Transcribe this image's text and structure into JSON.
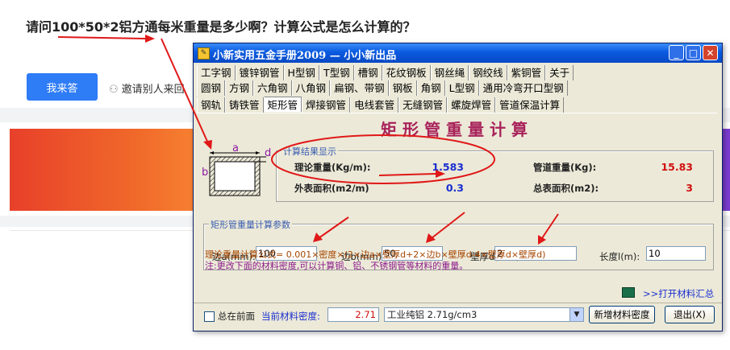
{
  "page": {
    "question_title": "请问100*50*2铝方通每米重量是多少啊？计算公式是怎么计算的？",
    "answer_button": "我来答",
    "invite_text": "邀请别人来回"
  },
  "window": {
    "title": "小新实用五金手册2009 — 小小新出品",
    "tabs_row1": [
      "工字钢",
      "镀锌钢管",
      "H型钢",
      "T型钢",
      "槽钢",
      "花纹钢板",
      "钢丝绳",
      "钢绞线",
      "紫铜管",
      "关于"
    ],
    "tabs_row2": [
      "圆钢",
      "方钢",
      "六角钢",
      "八角钢",
      "扁钢、带钢",
      "钢板",
      "角钢",
      "L型钢",
      "通用冷弯开口型钢"
    ],
    "tabs_row3": [
      "钢轨",
      "铸铁管",
      "矩形管",
      "焊接钢管",
      "电线套管",
      "无缝钢管",
      "螺旋焊管",
      "管道保温计算"
    ],
    "active_tab": "矩形管"
  },
  "calc": {
    "title": "矩形管重量计算",
    "diagram_labels": {
      "a": "a",
      "b": "b",
      "d": "d"
    },
    "result_group": "计算结果显示",
    "theory_weight_label": "理论重量(Kg/m):",
    "theory_weight_value": "1.583",
    "pipe_weight_label": "管道重量(Kg):",
    "pipe_weight_value": "15.83",
    "outer_area_label": "外表面积(m2/m)",
    "outer_area_value": "0.3",
    "total_area_label": "总表面积(m2):",
    "total_area_value": "3",
    "param_group": "矩形管重量计算参数",
    "side_a_label": "边a(mm):",
    "side_a_value": "100",
    "side_b_label": "边b(mm):",
    "side_b_value": "50",
    "thickness_label": "壁厚d(mm)",
    "thickness_value": "2",
    "length_label": "长度l(m):",
    "length_value": "10",
    "formula": "理论重量计算公式=  0.001×密度×(2×边a×壁厚d+2×边b×壁厚d-4×壁厚d×壁厚d)",
    "note": "注:更改下面的材料密度,可以计算铜、铝、不锈钢管等材料的重量。",
    "open_materials": ">>打开材料汇总"
  },
  "bottom": {
    "always_on_top": "总在前面",
    "density_label": "当前材料密度:",
    "density_value": "2.71",
    "material_selected": "工业纯铝 2.71g/cm3",
    "add_density_button": "新增材料密度",
    "exit_button": "退出(X)"
  },
  "colors": {
    "annotation_red": "#e01818",
    "title_bar": "#0a5ae0",
    "value_blue": "#1a2fd0",
    "value_red": "#d01010",
    "calc_title": "#a8225a"
  }
}
